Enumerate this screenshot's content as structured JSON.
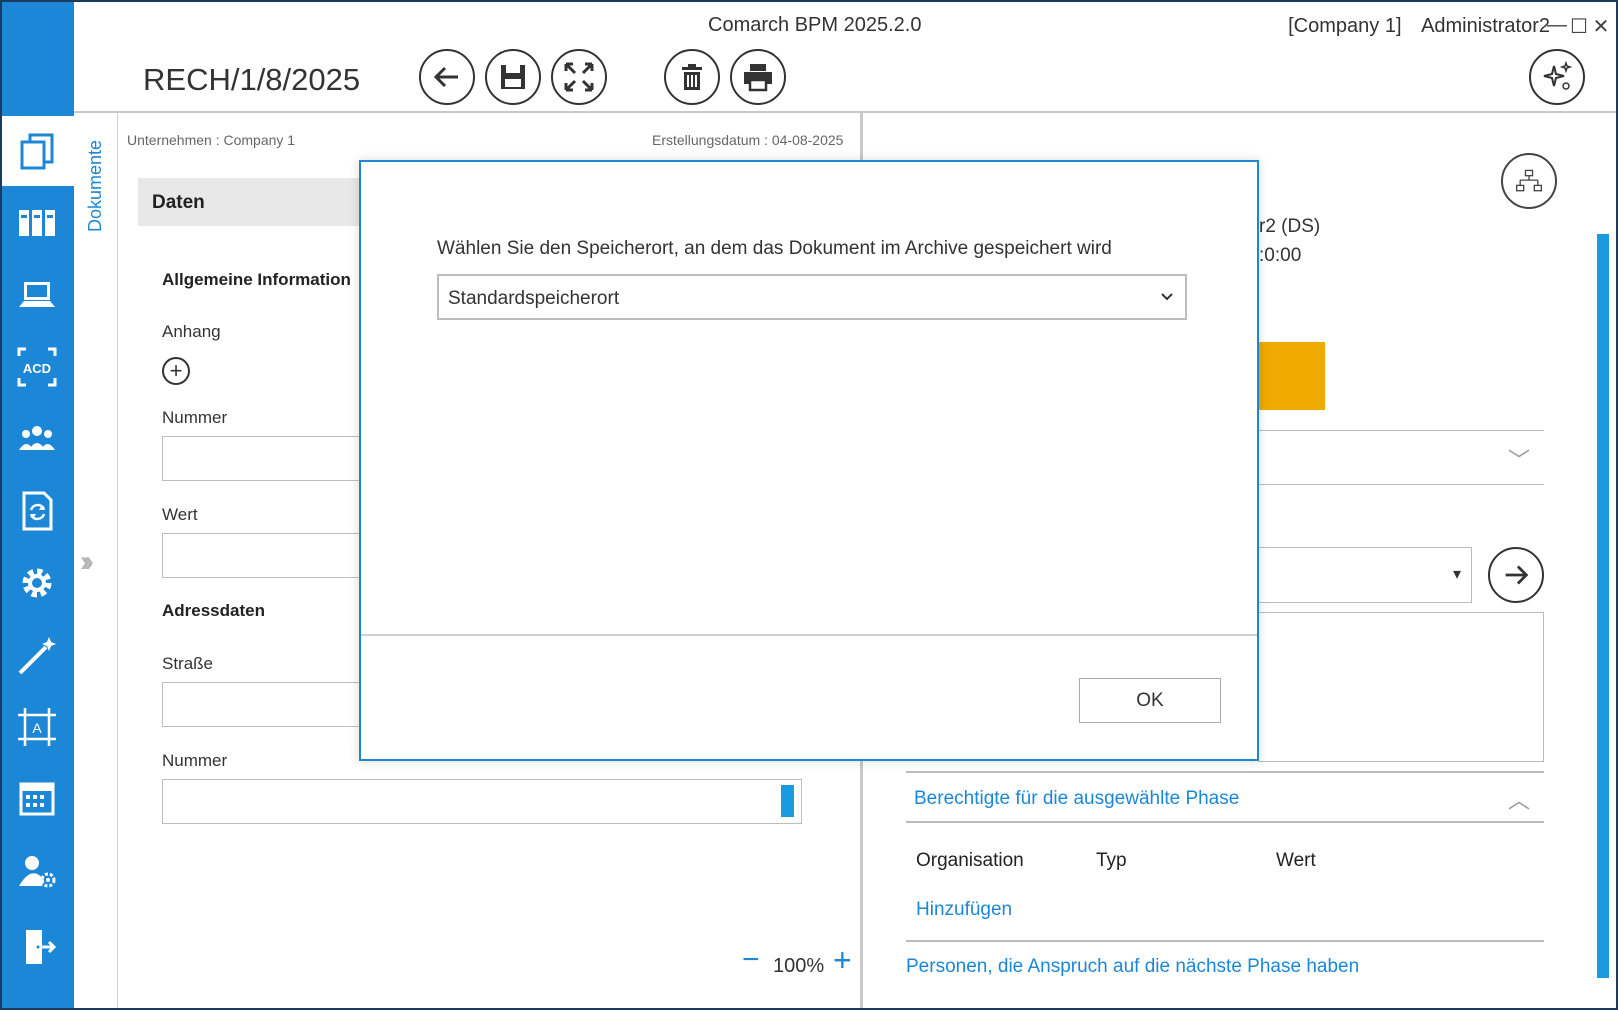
{
  "window": {
    "app_title": "Comarch BPM 2025.2.0",
    "company": "[Company 1]",
    "user": "Administrator2",
    "minimize": "—",
    "maximize": "☐",
    "close": "✕"
  },
  "header": {
    "document_number": "RECH/1/8/2025",
    "toolbar_icons": [
      "back-arrow-icon",
      "save-icon",
      "fullscreen-icon",
      "delete-icon",
      "print-icon",
      "ai-sparkle-icon"
    ]
  },
  "sidebar": {
    "items": [
      {
        "icon": "documents-icon"
      },
      {
        "icon": "archive-binders-icon"
      },
      {
        "icon": "laptop-icon"
      },
      {
        "icon": "acd-scan-icon"
      },
      {
        "icon": "users-group-icon"
      },
      {
        "icon": "document-sync-icon"
      },
      {
        "icon": "gear-icon"
      },
      {
        "icon": "magic-wand-icon"
      },
      {
        "icon": "form-designer-icon"
      },
      {
        "icon": "calendar-icon"
      },
      {
        "icon": "user-settings-icon"
      },
      {
        "icon": "logout-door-icon"
      }
    ]
  },
  "left_panel": {
    "vertical_tab": "Dokumente",
    "company_meta": "Unternehmen : Company 1",
    "created_meta": "Erstellungsdatum : 04-08-2025",
    "daten_header": "Daten",
    "section_general": "Allgemeine Information",
    "label_anhang": "Anhang",
    "label_nummer": "Nummer",
    "label_wert": "Wert",
    "section_address": "Adressdaten",
    "label_strasse": "Straße",
    "label_nummer2": "Nummer",
    "zoom_minus": "−",
    "zoom_level": "100%",
    "zoom_plus": "+"
  },
  "right_panel": {
    "ds_line1": "r2 (DS)",
    "ds_line2": ":0:00",
    "section_berechtigte": "Berechtigte für die ausgewählte Phase",
    "columns": [
      "Organisation",
      "Typ",
      "Wert"
    ],
    "add_link": "Hinzufügen",
    "next_phase_link": "Personen, die Anspruch auf die nächste Phase haben",
    "accent_color": "#f0aa00"
  },
  "modal": {
    "prompt": "Wählen Sie den Speicherort, an dem das Dokument im Archive gespeichert wird",
    "selected_location": "Standardspeicherort",
    "ok_label": "OK"
  },
  "colors": {
    "brand_blue": "#1c87d6",
    "orange": "#f0aa00"
  }
}
